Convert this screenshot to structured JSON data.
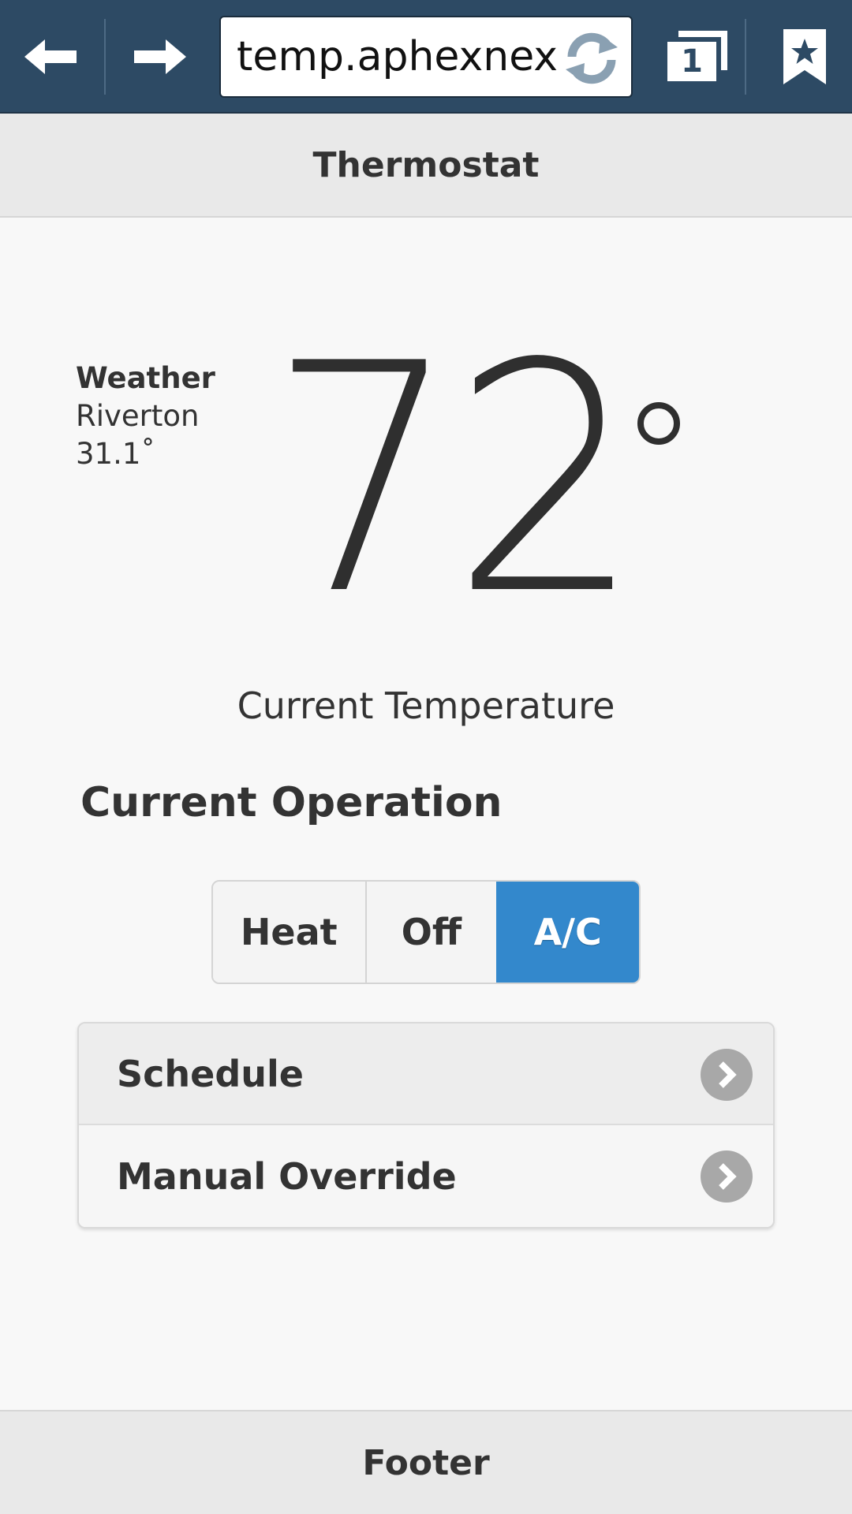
{
  "browser": {
    "url": "temp.aphexnexu",
    "tab_count": "1",
    "icons": [
      "back-arrow-icon",
      "forward-arrow-icon",
      "reload-icon",
      "tabs-icon",
      "bookmark-star-icon"
    ],
    "colors": {
      "toolbar": "#2d4a64"
    }
  },
  "header": {
    "title": "Thermostat"
  },
  "weather": {
    "title": "Weather",
    "location": "Riverton",
    "temperature": "31.1˚"
  },
  "thermostat": {
    "current_temp": "72",
    "current_temp_label": "Current Temperature"
  },
  "operation": {
    "heading": "Current Operation",
    "options": [
      "Heat",
      "Off",
      "A/C"
    ],
    "selected": "A/C",
    "colors": {
      "selected": "#3388cc"
    }
  },
  "menu": {
    "items": [
      {
        "label": "Schedule",
        "icon": "chevron-right-icon"
      },
      {
        "label": "Manual Override",
        "icon": "chevron-right-icon"
      }
    ]
  },
  "footer": {
    "text": "Footer"
  }
}
